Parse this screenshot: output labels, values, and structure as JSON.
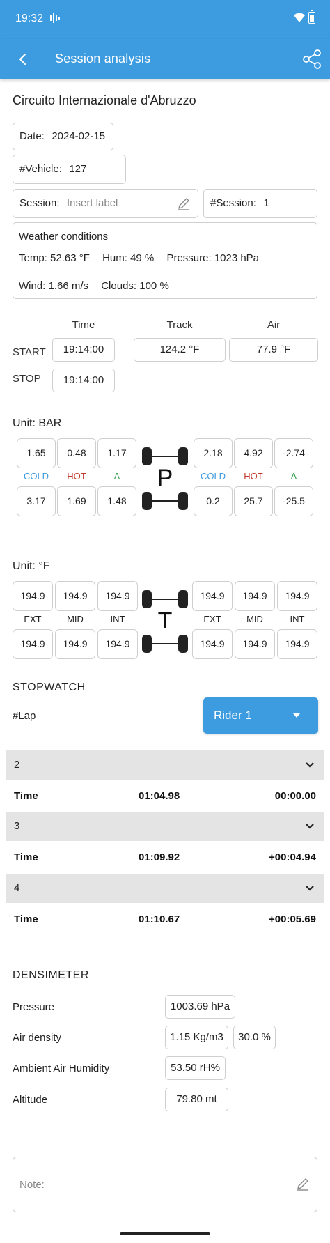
{
  "status_bar": {
    "time": "19:32"
  },
  "app_bar": {
    "title": "Session analysis",
    "back_icon": "back-arrow-icon",
    "share_icon": "share-icon"
  },
  "circuit": "Circuito Internazionale d'Abruzzo",
  "session": {
    "date_label": "Date:",
    "date_value": "2024-02-15",
    "vehicle_label": "#Vehicle:",
    "vehicle_value": "127",
    "session_label": "Session:",
    "session_placeholder": "Insert label",
    "session_num_label": "#Session:",
    "session_num_value": "1"
  },
  "weather": {
    "title": "Weather conditions",
    "temp": "Temp: 52.63 °F",
    "hum": "Hum: 49 %",
    "pressure": "Pressure: 1023 hPa",
    "wind": "Wind: 1.66 m/s",
    "clouds": "Clouds: 100 %"
  },
  "times": {
    "col_time": "Time",
    "col_track": "Track",
    "col_air": "Air",
    "start_label": "START",
    "stop_label": "STOP",
    "start_time": "19:14:00",
    "stop_time": "19:14:00",
    "track": "124.2 °F",
    "air": "77.9 °F"
  },
  "pressure": {
    "unit": "Unit: BAR",
    "letter": "P",
    "labels": [
      "COLD",
      "HOT",
      "Δ"
    ],
    "front_left": [
      "1.65",
      "0.48",
      "1.17"
    ],
    "front_right": [
      "2.18",
      "4.92",
      "-2.74"
    ],
    "rear_left": [
      "3.17",
      "1.69",
      "1.48"
    ],
    "rear_right": [
      "0.2",
      "25.7",
      "-25.5"
    ]
  },
  "temperature": {
    "unit": "Unit: °F",
    "letter": "T",
    "labels": [
      "EXT",
      "MID",
      "INT"
    ],
    "front_left": [
      "194.9",
      "194.9",
      "194.9"
    ],
    "front_right": [
      "194.9",
      "194.9",
      "194.9"
    ],
    "rear_left": [
      "194.9",
      "194.9",
      "194.9"
    ],
    "rear_right": [
      "194.9",
      "194.9",
      "194.9"
    ]
  },
  "stopwatch": {
    "title": "STOPWATCH",
    "lap_label": "#Lap",
    "rider": "Rider 1",
    "laps": [
      {
        "num": "2",
        "label": "Time",
        "time": "01:04.98",
        "delta": "00:00.00"
      },
      {
        "num": "3",
        "label": "Time",
        "time": "01:09.92",
        "delta": "+00:04.94"
      },
      {
        "num": "4",
        "label": "Time",
        "time": "01:10.67",
        "delta": "+00:05.69"
      }
    ]
  },
  "densimeter": {
    "title": "DENSIMETER",
    "pressure_label": "Pressure",
    "pressure_value": "1003.69 hPa",
    "density_label": "Air density",
    "density_value": "1.15 Kg/m3",
    "density_pct": "30.0 %",
    "humidity_label": "Ambient Air Humidity",
    "humidity_value": "53.50 rH%",
    "altitude_label": "Altitude",
    "altitude_value": "79.80 mt"
  },
  "note": {
    "placeholder": "Note:"
  },
  "colors": {
    "primary": "#3d9be0",
    "cold": "#3d9be0",
    "hot": "#c0392b",
    "delta": "#2e9e4a",
    "lap_bar": "#e4e4e4"
  }
}
